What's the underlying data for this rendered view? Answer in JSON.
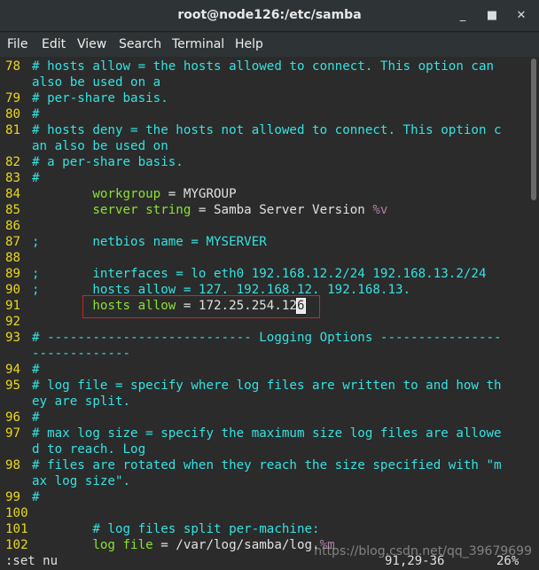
{
  "window": {
    "title": "root@node126:/etc/samba"
  },
  "controls": {
    "minimize": "_",
    "maximize": "■",
    "close": "✕"
  },
  "menu": [
    "File",
    "Edit",
    "View",
    "Search",
    "Terminal",
    "Help"
  ],
  "lines": [
    {
      "ln": "78",
      "parts": [
        [
          "cm",
          "# hosts allow = the hosts allowed to connect. This option can"
        ]
      ]
    },
    {
      "ln": "",
      "parts": [
        [
          "cm",
          "also be used on a"
        ]
      ]
    },
    {
      "ln": "79",
      "parts": [
        [
          "cm",
          "# per-share basis."
        ]
      ]
    },
    {
      "ln": "80",
      "parts": [
        [
          "cm",
          "#"
        ]
      ]
    },
    {
      "ln": "81",
      "parts": [
        [
          "cm",
          "# hosts deny = the hosts not allowed to connect. This option c"
        ]
      ]
    },
    {
      "ln": "",
      "parts": [
        [
          "cm",
          "an also be used on"
        ]
      ]
    },
    {
      "ln": "82",
      "parts": [
        [
          "cm",
          "# a per-share basis."
        ]
      ]
    },
    {
      "ln": "83",
      "parts": [
        [
          "cm",
          "#"
        ]
      ]
    },
    {
      "ln": "84",
      "parts": [
        [
          "tx",
          "        "
        ],
        [
          "kw",
          "workgroup"
        ],
        [
          "tx",
          " = MYGROUP"
        ]
      ]
    },
    {
      "ln": "85",
      "parts": [
        [
          "tx",
          "        "
        ],
        [
          "kw",
          "server string"
        ],
        [
          "tx",
          " = Samba Server Version "
        ],
        [
          "pr",
          "%v"
        ]
      ]
    },
    {
      "ln": "86",
      "parts": []
    },
    {
      "ln": "87",
      "parts": [
        [
          "cm",
          ";       netbios name = MYSERVER"
        ]
      ]
    },
    {
      "ln": "88",
      "parts": []
    },
    {
      "ln": "89",
      "parts": [
        [
          "cm",
          ";       interfaces = lo eth0 192.168.12.2/24 192.168.13.2/24"
        ]
      ]
    },
    {
      "ln": "90",
      "parts": [
        [
          "cm",
          ";       hosts allow = 127. 192.168.12. 192.168.13."
        ]
      ]
    },
    {
      "ln": "91",
      "parts": [
        [
          "tx",
          "        "
        ],
        [
          "kw",
          "hosts allow"
        ],
        [
          "tx",
          " = 172.25.254.12"
        ],
        [
          "cur",
          "6"
        ]
      ]
    },
    {
      "ln": "92",
      "parts": []
    },
    {
      "ln": "93",
      "parts": [
        [
          "cm",
          "# --------------------------- Logging Options ----------------"
        ]
      ]
    },
    {
      "ln": "",
      "parts": [
        [
          "cm",
          "-------------"
        ]
      ]
    },
    {
      "ln": "94",
      "parts": [
        [
          "cm",
          "#"
        ]
      ]
    },
    {
      "ln": "95",
      "parts": [
        [
          "cm",
          "# log file = specify where log files are written to and how th"
        ]
      ]
    },
    {
      "ln": "",
      "parts": [
        [
          "cm",
          "ey are split."
        ]
      ]
    },
    {
      "ln": "96",
      "parts": [
        [
          "cm",
          "#"
        ]
      ]
    },
    {
      "ln": "97",
      "parts": [
        [
          "cm",
          "# max log size = specify the maximum size log files are allowe"
        ]
      ]
    },
    {
      "ln": "",
      "parts": [
        [
          "cm",
          "d to reach. Log"
        ]
      ]
    },
    {
      "ln": "98",
      "parts": [
        [
          "cm",
          "# files are rotated when they reach the size specified with \"m"
        ]
      ]
    },
    {
      "ln": "",
      "parts": [
        [
          "cm",
          "ax log size\"."
        ]
      ]
    },
    {
      "ln": "99",
      "parts": [
        [
          "cm",
          "#"
        ]
      ]
    },
    {
      "ln": "100",
      "parts": []
    },
    {
      "ln": "101",
      "parts": [
        [
          "tx",
          "        "
        ],
        [
          "cm",
          "# log files split per-machine:"
        ]
      ]
    },
    {
      "ln": "102",
      "parts": [
        [
          "tx",
          "        "
        ],
        [
          "kw",
          "log file"
        ],
        [
          "tx",
          " = /var/log/samba/log."
        ],
        [
          "pr",
          "%m"
        ]
      ]
    }
  ],
  "status": {
    "command": ":set nu",
    "position": "91,29-36",
    "percent": "26%"
  },
  "watermark": "https://blog.csdn.net/qq_39679699"
}
